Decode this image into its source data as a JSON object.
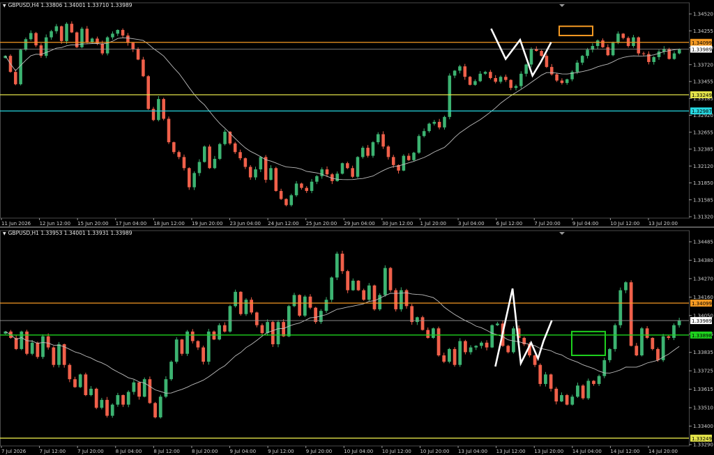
{
  "colors": {
    "bull": "#3cb371",
    "bear": "#f0604a",
    "ma": "#bdbdbd",
    "grid": "#303030",
    "orange": "#f59a23",
    "yellow": "#e3e34a",
    "cyan": "#27d7e0",
    "green": "#1ed21e",
    "white": "#ffffff",
    "current": "#9a9a9a"
  },
  "chart_data": [
    {
      "type": "candlestick",
      "header": {
        "symbol": "GBPUSD,H4",
        "ohlc": "1.33806 1.34001 1.33710 1.33989"
      },
      "ylim": [
        1.3125,
        1.3465
      ],
      "y_ticks": [
        "1.34520",
        "1.34255",
        "1.33989",
        "1.33720",
        "1.33455",
        "1.33185",
        "1.32920",
        "1.32655",
        "1.32385",
        "1.32120",
        "1.31850",
        "1.31585",
        "1.31320"
      ],
      "x_ticks": [
        "11 Jun 2026",
        "12 Jun 12:00",
        "15 Jun 20:00",
        "17 Jun 04:00",
        "18 Jun 12:00",
        "19 Jun 20:00",
        "23 Jun 04:00",
        "24 Jun 12:00",
        "25 Jun 20:00",
        "29 Jun 04:00",
        "30 Jun 12:00",
        "1 Jul 20:00",
        "3 Jul 04:00",
        "6 Jul 12:00",
        "7 Jul 20:00",
        "9 Jul 04:00",
        "10 Jul 12:00",
        "13 Jul 20:00"
      ],
      "levels": [
        {
          "label": "1.34099",
          "value": 1.34099,
          "color": "orange"
        },
        {
          "label": "1.33989",
          "value": 1.33989,
          "color": "current"
        },
        {
          "label": "1.33249",
          "value": 1.33249,
          "color": "yellow"
        },
        {
          "label": "1.32987",
          "value": 1.32987,
          "color": "cyan"
        }
      ],
      "closes": [
        1.3388,
        1.3362,
        1.3342,
        1.3398,
        1.3415,
        1.3425,
        1.3405,
        1.3388,
        1.3418,
        1.3428,
        1.3436,
        1.3412,
        1.344,
        1.3426,
        1.3402,
        1.3432,
        1.341,
        1.3416,
        1.3408,
        1.3392,
        1.3418,
        1.3424,
        1.343,
        1.3421,
        1.3409,
        1.3399,
        1.3382,
        1.3355,
        1.3302,
        1.3284,
        1.3318,
        1.3286,
        1.3248,
        1.3232,
        1.3224,
        1.3206,
        1.3175,
        1.3198,
        1.3216,
        1.3241,
        1.3206,
        1.3221,
        1.3245,
        1.3265,
        1.3246,
        1.3232,
        1.3222,
        1.3208,
        1.3191,
        1.3204,
        1.3224,
        1.3187,
        1.3206,
        1.3169,
        1.3156,
        1.3146,
        1.3162,
        1.3181,
        1.3174,
        1.3169,
        1.3184,
        1.3193,
        1.3204,
        1.3196,
        1.3185,
        1.3197,
        1.3214,
        1.3206,
        1.3192,
        1.3224,
        1.3239,
        1.3226,
        1.3248,
        1.3261,
        1.3241,
        1.3224,
        1.3211,
        1.3202,
        1.3226,
        1.3219,
        1.3231,
        1.3258,
        1.3266,
        1.3278,
        1.3281,
        1.3272,
        1.3289,
        1.3356,
        1.3364,
        1.3371,
        1.3354,
        1.3341,
        1.3347,
        1.3359,
        1.3362,
        1.3352,
        1.3346,
        1.3354,
        1.3349,
        1.3336,
        1.3339,
        1.3359,
        1.3374,
        1.3399,
        1.3396,
        1.3388,
        1.337,
        1.3358,
        1.3348,
        1.3344,
        1.335,
        1.3362,
        1.3377,
        1.3388,
        1.3398,
        1.3404,
        1.3413,
        1.3402,
        1.3389,
        1.3409,
        1.3424,
        1.3417,
        1.3404,
        1.3418,
        1.3392,
        1.3391,
        1.3378,
        1.3386,
        1.3395,
        1.3399,
        1.3383,
        1.3392,
        1.3399
      ],
      "pattern_x": [
        0.713,
        0.734,
        0.755,
        0.773,
        0.785,
        0.8
      ],
      "pattern_y": [
        1.3432,
        1.3383,
        1.3414,
        1.3356,
        1.3378,
        1.341
      ],
      "zone": {
        "y0": 1.3421,
        "y1": 1.3436
      }
    },
    {
      "type": "candlestick",
      "header": {
        "symbol": "GBPUSD,H1",
        "ohlc": "1.33953 1.34001 1.33931 1.33989"
      },
      "ylim": [
        1.332,
        1.3452
      ],
      "y_ticks": [
        "1.34485",
        "1.34380",
        "1.34270",
        "1.34160",
        "1.34050",
        "1.33945",
        "1.33835",
        "1.33725",
        "1.33615",
        "1.33510",
        "1.33400",
        "1.33290"
      ],
      "x_ticks": [
        "7 Jul 2026",
        "7 Jul 12:00",
        "7 Jul 20:00",
        "8 Jul 04:00",
        "8 Jul 12:00",
        "8 Jul 20:00",
        "9 Jul 04:00",
        "9 Jul 12:00",
        "9 Jul 20:00",
        "10 Jul 04:00",
        "10 Jul 12:00",
        "10 Jul 20:00",
        "13 Jul 04:00",
        "13 Jul 12:00",
        "13 Jul 20:00",
        "14 Jul 04:00",
        "14 Jul 12:00",
        "14 Jul 20:00"
      ],
      "levels": [
        {
          "label": "1.34099",
          "value": 1.34099,
          "color": "orange"
        },
        {
          "label": "1.33989",
          "value": 1.33989,
          "color": "current"
        },
        {
          "label": "1.33898",
          "value": 1.33898,
          "color": "green"
        },
        {
          "label": "1.33249",
          "value": 1.33249,
          "color": "yellow"
        }
      ],
      "closes": [
        1.3392,
        1.3388,
        1.3381,
        1.3392,
        1.3378,
        1.3385,
        1.3376,
        1.3389,
        1.3382,
        1.3371,
        1.3384,
        1.3371,
        1.3362,
        1.3357,
        1.3365,
        1.3352,
        1.3356,
        1.3344,
        1.3349,
        1.3339,
        1.3346,
        1.3352,
        1.3346,
        1.3354,
        1.336,
        1.3351,
        1.3362,
        1.3347,
        1.3338,
        1.3351,
        1.3362,
        1.3373,
        1.3387,
        1.3378,
        1.3392,
        1.3386,
        1.3382,
        1.3373,
        1.3392,
        1.3387,
        1.3396,
        1.3392,
        1.3408,
        1.3417,
        1.3403,
        1.3412,
        1.3404,
        1.3396,
        1.3391,
        1.3398,
        1.3384,
        1.3398,
        1.3389,
        1.3408,
        1.3415,
        1.3402,
        1.3414,
        1.3407,
        1.3398,
        1.3405,
        1.3412,
        1.3426,
        1.3441,
        1.343,
        1.3418,
        1.3424,
        1.3418,
        1.3412,
        1.3421,
        1.3406,
        1.3415,
        1.3432,
        1.3418,
        1.3406,
        1.3418,
        1.3408,
        1.3398,
        1.3401,
        1.3393,
        1.3388,
        1.3394,
        1.3377,
        1.3373,
        1.3381,
        1.3371,
        1.3386,
        1.3379,
        1.3382,
        1.3383,
        1.3385,
        1.3382,
        1.3396,
        1.3397,
        1.3383,
        1.3379,
        1.3394,
        1.3388,
        1.3384,
        1.3377,
        1.3371,
        1.3359,
        1.3365,
        1.3356,
        1.3348,
        1.3352,
        1.3346,
        1.3351,
        1.3358,
        1.335,
        1.3361,
        1.3359,
        1.3364,
        1.3374,
        1.3381,
        1.3396,
        1.3418,
        1.3423,
        1.3383,
        1.3377,
        1.3394,
        1.3388,
        1.3381,
        1.3374,
        1.3389,
        1.3388,
        1.3396,
        1.3399
      ],
      "pattern_x": [
        0.719,
        0.744,
        0.756,
        0.771,
        0.781,
        0.789,
        0.801
      ],
      "pattern_y": [
        1.337,
        1.3419,
        1.3372,
        1.3385,
        1.3375,
        1.3386,
        1.3399
      ],
      "zone": {
        "y0": 1.3377,
        "y1": 1.3392
      }
    }
  ]
}
